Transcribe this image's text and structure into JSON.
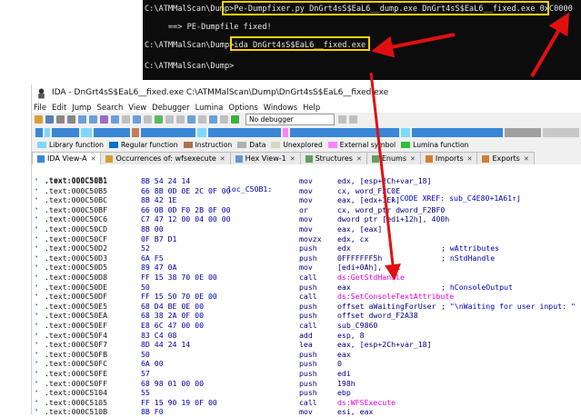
{
  "console": {
    "lines": [
      "C:\\ATMMalScan\\Dump>Pe-Dumpfixer.py DnGrt4sS$EaL6__dump.exe DnGrt4sS$EaL6__fixed.exe 0xC0000",
      "     ==> PE-Dumpfile fixed!",
      "C:\\ATMMalScan\\Dump>ida DnGrt4sS$EaL6__fixed.exe",
      "C:\\ATMMalScan\\Dump>"
    ]
  },
  "ida": {
    "title": "IDA - DnGrt4sS$EaL6__fixed.exe C:\\ATMMalScan\\Dump\\DnGrt4sS$EaL6__fixed.exe",
    "menu": [
      "File",
      "Edit",
      "Jump",
      "Search",
      "View",
      "Debugger",
      "Lumina",
      "Options",
      "Windows",
      "Help"
    ],
    "debugger_select": "No debugger",
    "legend": [
      "Library function",
      "Regular function",
      "Instruction",
      "Data",
      "Unexplored",
      "External symbol",
      "Lumina function"
    ],
    "tabs": [
      "IDA View-A",
      "Occurrences of: wfsexecute",
      "Hex View-1",
      "Structures",
      "Enums",
      "Imports",
      "Exports"
    ],
    "code": {
      "label_row": {
        "addr": ".text:000C50B1",
        "label": "loc_C50B1:",
        "comment": "; CODE XREF: sub_C4E80+1A61↑j"
      },
      "rows": [
        {
          "addr": ".text:000C50B1",
          "bytes": "8B 54 24 14",
          "mn": "mov",
          "op": "edx, [esp+2Ch+var_18]",
          "cm": ""
        },
        {
          "addr": ".text:000C50B5",
          "bytes": "66 8B 0D 0E 2C 0F 00",
          "mn": "mov",
          "op": "cx, word_F2C0E",
          "cm": ""
        },
        {
          "addr": ".text:000C50BC",
          "bytes": "8B 42 1E",
          "mn": "mov",
          "op": "eax, [edx+1Eh]",
          "cm": ""
        },
        {
          "addr": ".text:000C50BF",
          "bytes": "66 0B 0D F0 2B 0F 00",
          "mn": "or",
          "op": "cx, word_ptr dword_F2BF0",
          "cm": ""
        },
        {
          "addr": ".text:000C50C6",
          "bytes": "C7 47 12 00 04 00 00",
          "mn": "mov",
          "op": "dword ptr [edi+12h], 400h",
          "cm": ""
        },
        {
          "addr": ".text:000C50CD",
          "bytes": "8B 00",
          "mn": "mov",
          "op": "eax, [eax]",
          "cm": ""
        },
        {
          "addr": ".text:000C50CF",
          "bytes": "0F B7 D1",
          "mn": "movzx",
          "op": "edx, cx",
          "cm": ""
        },
        {
          "addr": ".text:000C50D2",
          "bytes": "52",
          "mn": "push",
          "op": "edx",
          "cm": "; wAttributes"
        },
        {
          "addr": ".text:000C50D3",
          "bytes": "6A F5",
          "mn": "push",
          "op": "0FFFFFFF5h",
          "cm": "; nStdHandle"
        },
        {
          "addr": ".text:000C50D5",
          "bytes": "89 47 0A",
          "mn": "mov",
          "op": "[edi+0Ah], eax",
          "cm": ""
        },
        {
          "addr": ".text:000C50D8",
          "bytes": "FF 15 38 70 0E 00",
          "mn": "call",
          "op": "ds:GetStdHandle",
          "cm": "",
          "imp": true
        },
        {
          "addr": ".text:000C50DE",
          "bytes": "50",
          "mn": "push",
          "op": "eax",
          "cm": "; hConsoleOutput"
        },
        {
          "addr": ".text:000C50DF",
          "bytes": "FF 15 50 70 0E 00",
          "mn": "call",
          "op": "ds:SetConsoleTextAttribute",
          "cm": "",
          "imp": true
        },
        {
          "addr": ".text:000C50E5",
          "bytes": "68 D4 BE 0E 00",
          "mn": "push",
          "op": "offset aWaitingForUser",
          "cm": "; \"\\nWaiting for user input: \""
        },
        {
          "addr": ".text:000C50EA",
          "bytes": "68 38 2A 0F 00",
          "mn": "push",
          "op": "offset dword_F2A38",
          "cm": ""
        },
        {
          "addr": ".text:000C50EF",
          "bytes": "E8 6C 47 00 00",
          "mn": "call",
          "op": "sub_C9860",
          "cm": ""
        },
        {
          "addr": ".text:000C50F4",
          "bytes": "83 C4 08",
          "mn": "add",
          "op": "esp, 8",
          "cm": ""
        },
        {
          "addr": ".text:000C50F7",
          "bytes": "8D 44 24 14",
          "mn": "lea",
          "op": "eax, [esp+2Ch+var_18]",
          "cm": ""
        },
        {
          "addr": ".text:000C50FB",
          "bytes": "50",
          "mn": "push",
          "op": "eax",
          "cm": ""
        },
        {
          "addr": ".text:000C50FC",
          "bytes": "6A 00",
          "mn": "push",
          "op": "0",
          "cm": ""
        },
        {
          "addr": ".text:000C50FE",
          "bytes": "57",
          "mn": "push",
          "op": "edi",
          "cm": ""
        },
        {
          "addr": ".text:000C50FF",
          "bytes": "68 98 01 00 00",
          "mn": "push",
          "op": "198h",
          "cm": ""
        },
        {
          "addr": ".text:000C5104",
          "bytes": "55",
          "mn": "push",
          "op": "ebp",
          "cm": ""
        },
        {
          "addr": ".text:000C5105",
          "bytes": "FF 15 90 19 0F 00",
          "mn": "call",
          "op": "ds:WFSExecute",
          "cm": "",
          "imp": true
        },
        {
          "addr": ".text:000C510B",
          "bytes": "8B F0",
          "mn": "mov",
          "op": "esi, eax",
          "cm": ""
        }
      ]
    }
  },
  "colors": {
    "highlight": "#ffd200",
    "arrow": "#e01010",
    "accent": "#1e90ff"
  }
}
